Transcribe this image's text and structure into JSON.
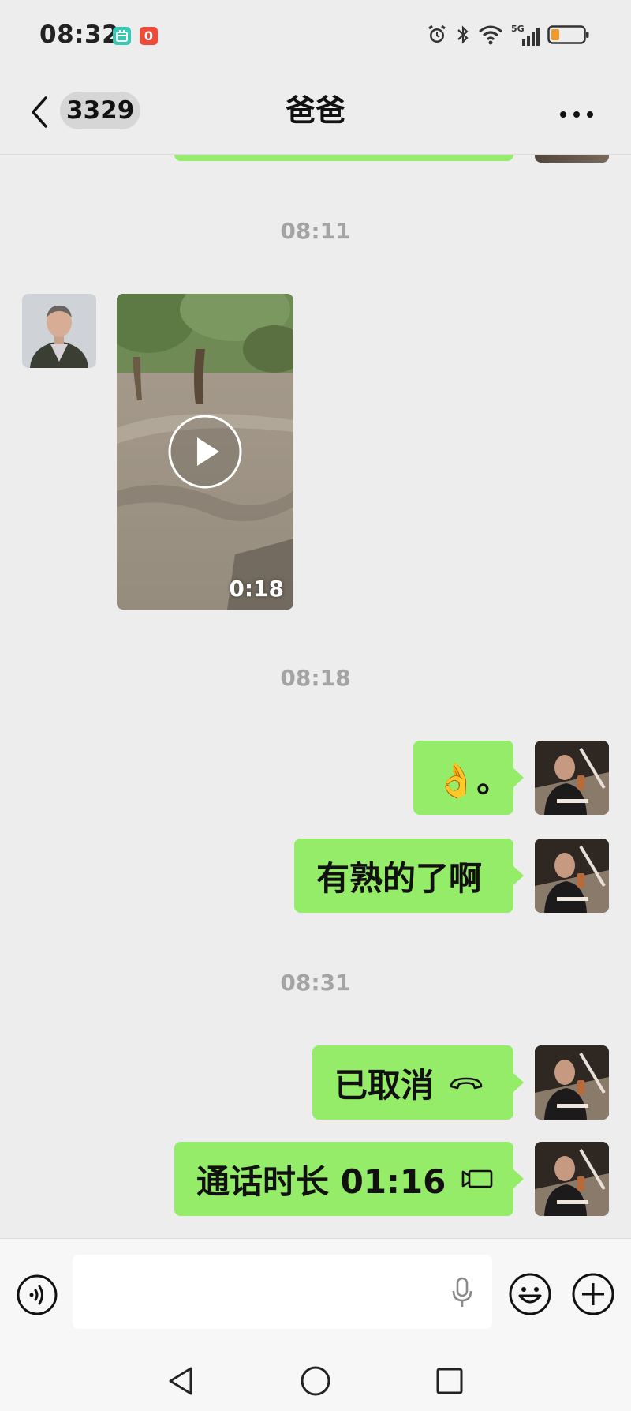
{
  "status_bar": {
    "time": "08:32",
    "app_badge_2": "0",
    "network": "5G",
    "icons": [
      "alarm-icon",
      "bluetooth-icon",
      "wifi-icon",
      "signal-icon",
      "battery-icon"
    ]
  },
  "header": {
    "unread_count": "3329",
    "contact_name": "爸爸",
    "icons": {
      "back": "chevron-left-icon",
      "more": "more-dots-icon"
    }
  },
  "messages": [
    {
      "type": "timestamp",
      "text": "08:11"
    },
    {
      "type": "video",
      "direction": "in",
      "duration": "0:18"
    },
    {
      "type": "timestamp",
      "text": "08:18"
    },
    {
      "type": "text",
      "direction": "out",
      "text": "👌。"
    },
    {
      "type": "text",
      "direction": "out",
      "text": "有熟的了啊"
    },
    {
      "type": "timestamp",
      "text": "08:31"
    },
    {
      "type": "call",
      "direction": "out",
      "text": "已取消",
      "icon": "hangup-icon"
    },
    {
      "type": "call",
      "direction": "out",
      "text": "通话时长 01:16",
      "icon": "video-call-icon"
    }
  ],
  "input_bar": {
    "value": "",
    "icons": [
      "voice-mode-icon",
      "mic-icon",
      "emoji-icon",
      "plus-icon"
    ]
  },
  "nav_bar": {
    "icons": [
      "nav-back-icon",
      "nav-home-icon",
      "nav-recent-icon"
    ]
  },
  "colors": {
    "background": "#ededed",
    "outgoing_bubble": "#95ec69",
    "timestamp_text": "#a4a4a4",
    "battery_low": "#f39a2c"
  }
}
